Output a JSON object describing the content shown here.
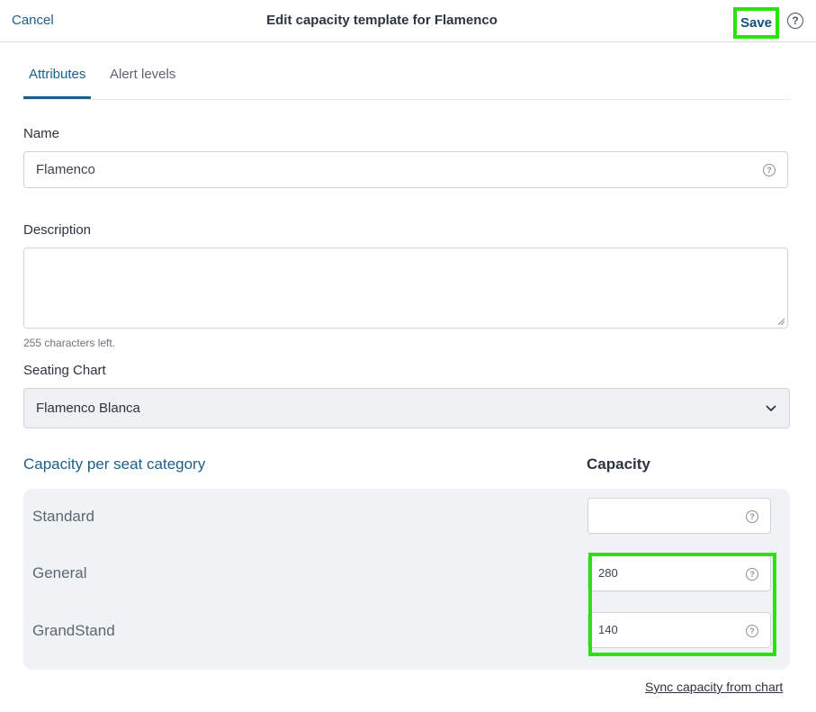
{
  "header": {
    "cancel_label": "Cancel",
    "title": "Edit capacity template for Flamenco",
    "save_label": "Save",
    "help_glyph": "?"
  },
  "tabs": [
    {
      "label": "Attributes",
      "active": true
    },
    {
      "label": "Alert levels",
      "active": false
    }
  ],
  "form": {
    "name_label": "Name",
    "name_value": "Flamenco",
    "description_label": "Description",
    "description_value": "",
    "description_hint": "255 characters left.",
    "seating_label": "Seating Chart",
    "seating_value": "Flamenco Blanca"
  },
  "capacity": {
    "section_title": "Capacity per seat category",
    "column_header": "Capacity",
    "categories": [
      {
        "name": "Standard",
        "value": ""
      },
      {
        "name": "General",
        "value": "280"
      },
      {
        "name": "GrandStand",
        "value": "140"
      }
    ],
    "sync_label": "Sync capacity from chart"
  },
  "colors": {
    "accent": "#1b5e8a",
    "highlight": "#2ee00f",
    "panel": "#f0f3f6"
  },
  "icons": {
    "help": "help-circle-icon",
    "dropdown": "chevron-down-icon"
  }
}
